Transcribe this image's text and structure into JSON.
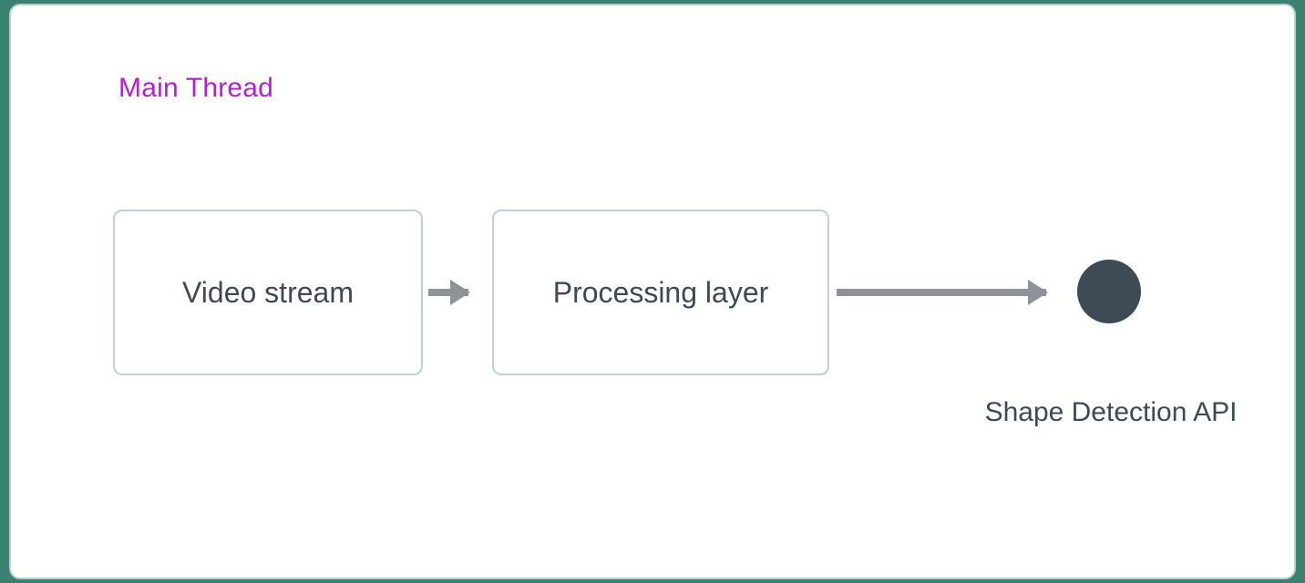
{
  "section_title": "Main Thread",
  "nodes": {
    "video": {
      "label": "Video stream"
    },
    "processing": {
      "label": "Processing layer"
    },
    "api": {
      "label": "Shape Detection API"
    }
  },
  "colors": {
    "accent_title": "#b41fd6",
    "box_border": "#bed0d8",
    "text": "#3c4a56",
    "arrow": "#8e9399",
    "dot": "#3e4a56",
    "panel_border": "#b9cdd6"
  }
}
